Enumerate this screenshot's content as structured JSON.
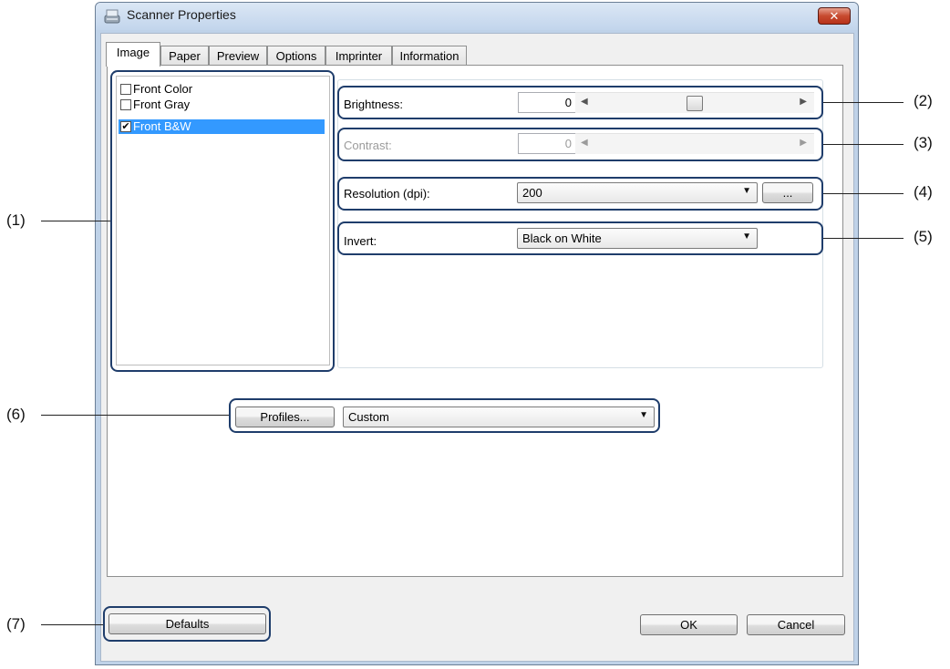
{
  "window": {
    "title": "Scanner Properties",
    "close_label": "✕"
  },
  "tabs": [
    {
      "label": "Image",
      "active": true
    },
    {
      "label": "Paper"
    },
    {
      "label": "Preview"
    },
    {
      "label": "Options"
    },
    {
      "label": "Imprinter"
    },
    {
      "label": "Information"
    }
  ],
  "image_types": [
    {
      "label": "Front Color",
      "checked": false,
      "selected": false
    },
    {
      "label": "Front Gray",
      "checked": false,
      "selected": false
    },
    {
      "label": "Front B&W",
      "checked": true,
      "selected": true
    }
  ],
  "brightness": {
    "label": "Brightness:",
    "value": "0",
    "level": 0.5
  },
  "contrast": {
    "label": "Contrast:",
    "value": "0",
    "enabled": false
  },
  "resolution": {
    "label": "Resolution (dpi):",
    "value": "200",
    "more_label": "..."
  },
  "invert": {
    "label": "Invert:",
    "value": "Black on White"
  },
  "profiles": {
    "button_label": "Profiles...",
    "value": "Custom"
  },
  "footer": {
    "defaults_label": "Defaults",
    "ok_label": "OK",
    "cancel_label": "Cancel"
  },
  "callouts": [
    "(1)",
    "(2)",
    "(3)",
    "(4)",
    "(5)",
    "(6)",
    "(7)"
  ],
  "colors": {
    "accent": "#1f3d6b",
    "selection": "#3399ff",
    "close": "#c74a2f"
  }
}
